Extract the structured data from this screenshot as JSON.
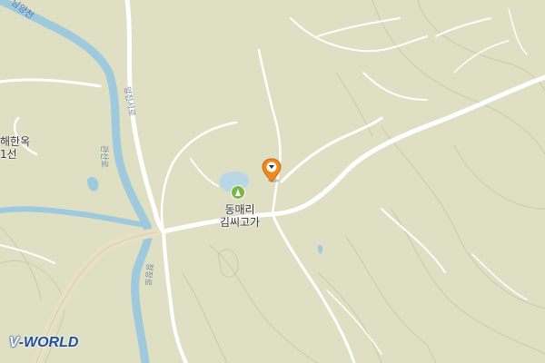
{
  "map": {
    "background_color": "#dedfc3",
    "river_color": "#9fc9dc",
    "road_color": "#ffffff",
    "expressway_color": "#e9e2c8",
    "contour_color": "#c9c9ab"
  },
  "labels": {
    "poi_name_line1": "동매리",
    "poi_name_line2": "김씨고가",
    "left_place_line1": "해한옥",
    "left_place_line2": "1선",
    "river_name": "남양천",
    "road_name_1": "양천서로",
    "road_name_2": "관산로",
    "road_name_3": "창장로"
  },
  "marker": {
    "icon": "map-pin-icon",
    "color": "#f08a1c"
  },
  "poi": {
    "icon": "monument-icon",
    "color": "#7ab648"
  },
  "logo": {
    "prefix": "V",
    "text": "-WORLD"
  }
}
